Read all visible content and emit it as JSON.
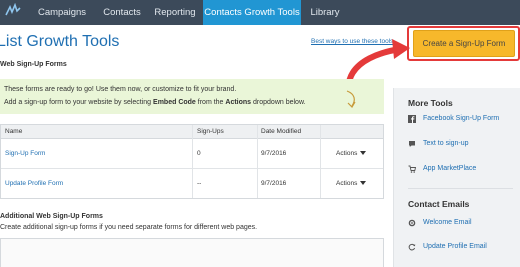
{
  "nav": {
    "items": [
      "Campaigns",
      "Contacts",
      "Reporting",
      "Contacts Growth Tools",
      "Library"
    ],
    "active": "Contacts Growth Tools"
  },
  "header": {
    "title": "List Growth Tools",
    "best_ways_link": "Best ways to use these tools",
    "cta_label": "Create a Sign-Up Form"
  },
  "web_forms": {
    "heading": "Web Sign-Up Forms",
    "notice_line1": "These forms are ready to go! Use them now, or customize to fit your brand.",
    "notice_line2_pre": "Add a sign-up form to your website by selecting ",
    "notice_line2_b1": "Embed Code",
    "notice_line2_mid": " from the ",
    "notice_line2_b2": "Actions",
    "notice_line2_post": " dropdown below.",
    "columns": [
      "Name",
      "Sign-Ups",
      "Date Modified"
    ],
    "rows": [
      {
        "name": "Sign-Up Form",
        "signups": "0",
        "date": "9/7/2016",
        "action": "Actions"
      },
      {
        "name": "Update Profile Form",
        "signups": "--",
        "date": "9/7/2016",
        "action": "Actions"
      }
    ]
  },
  "additional": {
    "heading": "Additional Web Sign-Up Forms",
    "sub": "Create additional sign-up forms if you need separate forms for different web pages."
  },
  "sidebar": {
    "more_tools_heading": "More Tools",
    "more_tools": [
      {
        "label": "Facebook Sign-Up Form",
        "icon": "facebook-icon"
      },
      {
        "label": "Text to sign-up",
        "icon": "chat-icon"
      },
      {
        "label": "App MarketPlace",
        "icon": "cart-icon"
      }
    ],
    "contact_emails_heading": "Contact Emails",
    "contact_emails": [
      {
        "label": "Welcome Email",
        "icon": "gear-icon"
      },
      {
        "label": "Update Profile Email",
        "icon": "refresh-icon"
      }
    ]
  },
  "colors": {
    "nav_bg": "#3c4a5a",
    "nav_active": "#2196d3",
    "cta": "#f7b82b",
    "annotation": "#e43a3a",
    "link": "#1f6fb2",
    "notice_bg": "#eaf6d8"
  }
}
